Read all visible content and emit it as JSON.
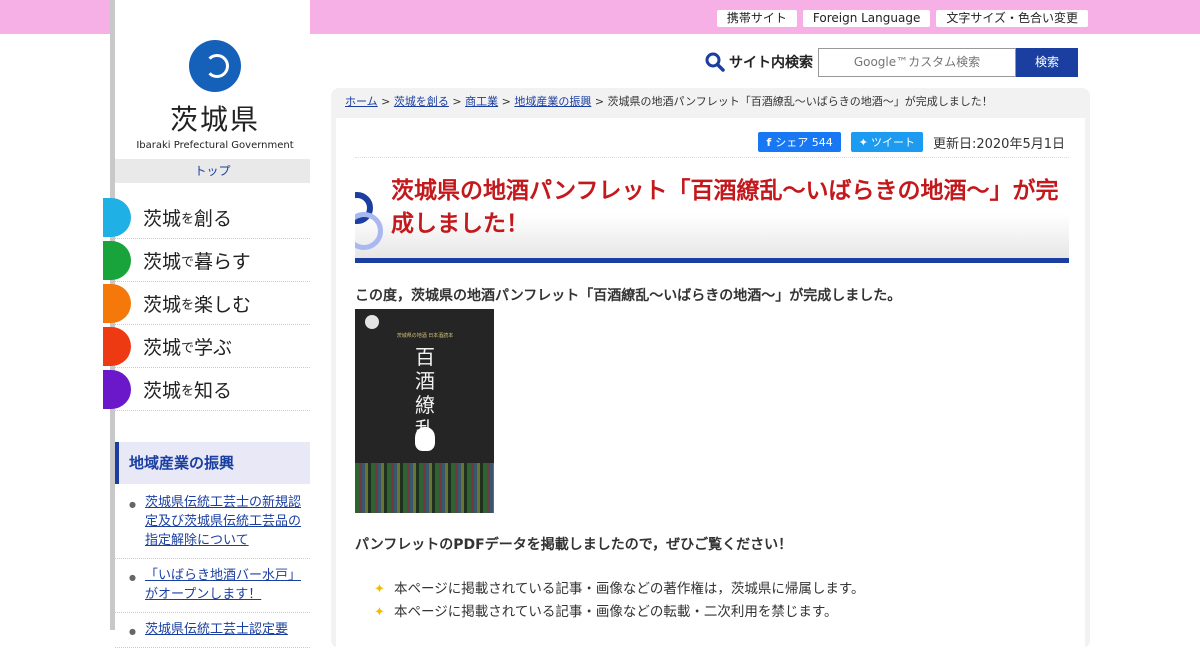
{
  "header": {
    "links": [
      "携帯サイト",
      "Foreign Language",
      "文字サイズ・色合い変更"
    ]
  },
  "logo": {
    "name": "茨城県",
    "en": "Ibaraki Prefectural Government"
  },
  "sidebar": {
    "top_label": "トップ",
    "nav": [
      {
        "pre": "茨城",
        "mid": "を",
        "post": "創る",
        "color": "#1fb0e6"
      },
      {
        "pre": "茨城",
        "mid": "で",
        "post": "暮らす",
        "color": "#18a43a"
      },
      {
        "pre": "茨城",
        "mid": "を",
        "post": "楽しむ",
        "color": "#f5780a"
      },
      {
        "pre": "茨城",
        "mid": "で",
        "post": "学ぶ",
        "color": "#ee3a12"
      },
      {
        "pre": "茨城",
        "mid": "を",
        "post": "知る",
        "color": "#6a18c9"
      }
    ],
    "section_title": "地域産業の振興",
    "section_items": [
      "茨城県伝統工芸士の新規認定及び茨城県伝統工芸品の指定解除について",
      "「いばらき地酒バー水戸」がオープンします！",
      "茨城県伝統工芸士認定要"
    ]
  },
  "search": {
    "label": "サイト内検索",
    "placeholder": "Google™カスタム検索",
    "button": "検索"
  },
  "breadcrumb": {
    "home": "ホーム",
    "l1": "茨城を創る",
    "l2": "商工業",
    "l3": "地域産業の振興",
    "current": "茨城県の地酒パンフレット「百酒繚乱～いばらきの地酒～」が完成しました！",
    "sep": ">"
  },
  "share": {
    "fb_label": "シェア 544",
    "tw_label": "ツイート",
    "updated": "更新日:2020年5月1日"
  },
  "article": {
    "title": "茨城県の地酒パンフレット「百酒繚乱～いばらきの地酒～」が完成しました！",
    "intro": "この度，茨城県の地酒パンフレット「百酒繚乱～いばらきの地酒～」が完成しました。",
    "poster_kanji": "百酒繚乱",
    "poster_small": "茨城県の地酒 日本酒読本",
    "pdf_text": "パンフレットのPDFデータを掲載しましたので，ぜひご覧ください！",
    "notes": [
      "本ページに掲載されている記事・画像などの著作権は，茨城県に帰属します。",
      "本ページに掲載されている記事・画像などの転載・二次利用を禁じます。"
    ]
  },
  "colors": {
    "topbar": "#f7b0e6",
    "accent": "#1a3fa0",
    "title_red": "#c3181c"
  }
}
